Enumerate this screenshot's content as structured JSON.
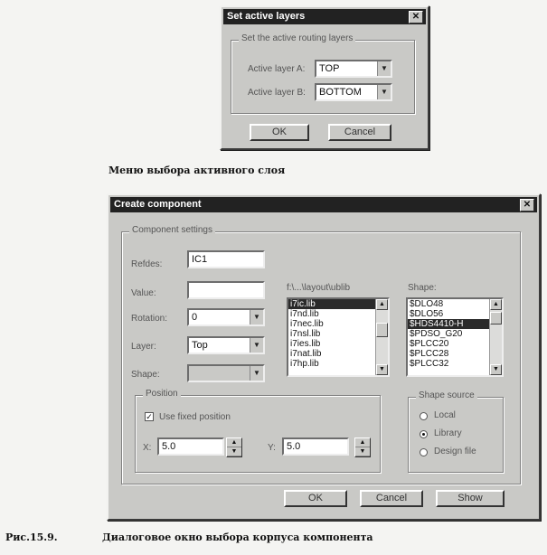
{
  "dialog1": {
    "title": "Set active layers",
    "group_label": "Set the active routing layers",
    "layer_a_label": "Active layer A:",
    "layer_a_value": "TOP",
    "layer_b_label": "Active layer B:",
    "layer_b_value": "BOTTOM",
    "ok_label": "OK",
    "cancel_label": "Cancel"
  },
  "caption1": "Меню выбора активного слоя",
  "dialog2": {
    "title": "Create component",
    "settings_group_label": "Component settings",
    "refdes_label": "Refdes:",
    "refdes_value": "IC1",
    "value_label": "Value:",
    "value_value": "",
    "rotation_label": "Rotation:",
    "rotation_value": "0",
    "layer_label": "Layer:",
    "layer_value": "Top",
    "shape_label": "Shape:",
    "shape_value": "",
    "library_path_label": "f:\\...\\layout\\ublib",
    "libraries": [
      "i7ic.lib",
      "i7nd.lib",
      "i7nec.lib",
      "i7nsl.lib",
      "i7ies.lib",
      "i7nat.lib",
      "i7hp.lib"
    ],
    "shape_list_label": "Shape:",
    "shapes": [
      "$DLO48",
      "$DLO56",
      "$HDS4410-H",
      "$PDSO_G20",
      "$PLCC20",
      "$PLCC28",
      "$PLCC32"
    ],
    "shapes_selected_index": 2,
    "position_group_label": "Position",
    "use_fixed_label": "Use fixed position",
    "use_fixed_checked": true,
    "x_label": "X:",
    "x_value": "5.0",
    "y_label": "Y:",
    "y_value": "5.0",
    "shape_source_label": "Shape source",
    "source_options": [
      "Local",
      "Library",
      "Design file"
    ],
    "source_selected": "Library",
    "ok_label": "OK",
    "cancel_label": "Cancel",
    "show_label": "Show"
  },
  "caption2_number": "Рис.15.9.",
  "caption2_text": "Диалоговое окно выбора корпуса компонента"
}
